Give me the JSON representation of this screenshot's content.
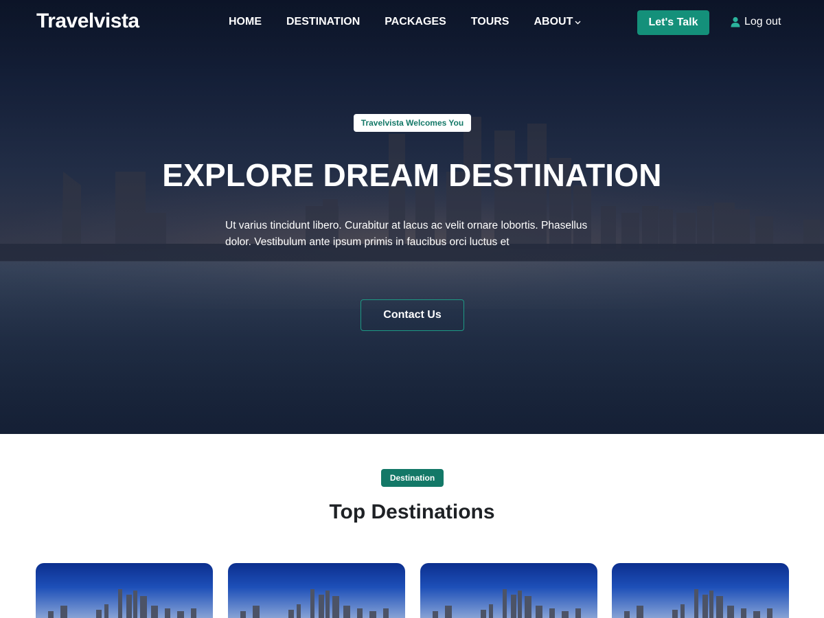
{
  "brand": {
    "name": "Travelvista"
  },
  "nav": {
    "items": [
      {
        "label": "HOME"
      },
      {
        "label": "DESTINATION"
      },
      {
        "label": "PACKAGES"
      },
      {
        "label": "TOURS"
      },
      {
        "label": "ABOUT"
      }
    ],
    "cta_label": "Let's Talk",
    "logout_label": "Log out"
  },
  "hero": {
    "badge": "Travelvista Welcomes You",
    "title": "EXPLORE DREAM DESTINATION",
    "text": "Ut varius tincidunt libero. Curabitur at lacus ac velit ornare lobortis. Phasellus dolor. Vestibulum ante ipsum primis in faucibus orci luctus et",
    "button": "Contact Us"
  },
  "destinations": {
    "badge": "Destination",
    "title": "Top Destinations"
  },
  "colors": {
    "accent": "#14907a",
    "accent_dark": "#137867",
    "text_dark": "#1e2125"
  },
  "icons": {
    "user": "user-icon",
    "dropdown": "chevron-down-icon"
  }
}
